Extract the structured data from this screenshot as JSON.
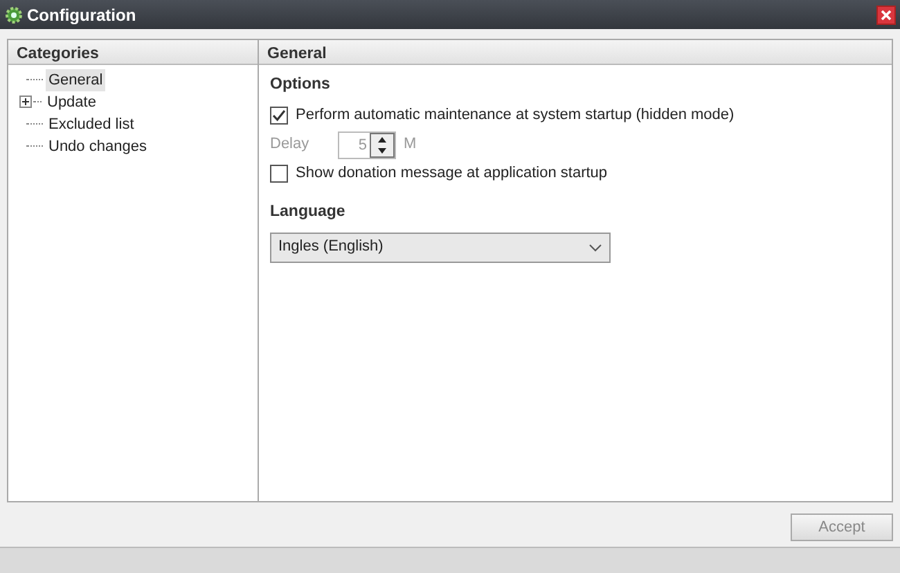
{
  "window": {
    "title": "Configuration"
  },
  "categories": {
    "heading": "Categories",
    "items": [
      {
        "label": "General",
        "selected": true
      },
      {
        "label": "Update",
        "selected": false,
        "expanded": false
      },
      {
        "label": "Excluded list",
        "selected": false
      },
      {
        "label": "Undo changes",
        "selected": false
      }
    ]
  },
  "panel": {
    "heading": "General",
    "options_heading": "Options",
    "maintenance": {
      "label": "Perform automatic maintenance at system startup (hidden mode)",
      "checked": true
    },
    "delay": {
      "label": "Delay",
      "value": "5",
      "unit": "M",
      "disabled": true
    },
    "donation": {
      "label": "Show donation message at application startup",
      "checked": false
    },
    "language_heading": "Language",
    "language": {
      "value": "Ingles (English)"
    }
  },
  "buttons": [
    {
      "label": "Accept"
    }
  ]
}
